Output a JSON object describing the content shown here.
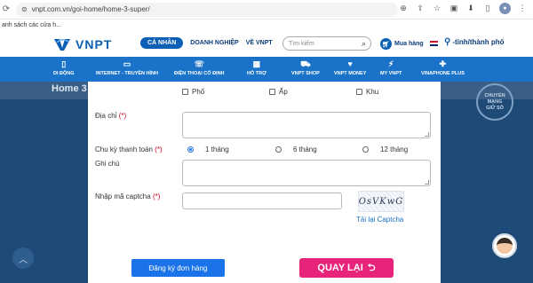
{
  "browser": {
    "url": "vnpt.com.vn/goi-home/home-3-super/",
    "bookmark_text": "anh sách các cửa h..."
  },
  "header": {
    "logo_text": "VNPT",
    "nav": [
      "CÁ NHÂN",
      "DOANH NGHIỆP",
      "VỀ VNPT"
    ],
    "search_placeholder": "Tìm kiếm",
    "cart_label": "Mua hàng",
    "location_label": "-tỉnh/thành phố"
  },
  "menu": [
    {
      "label": "DI ĐỘNG",
      "icon": "phone-icon"
    },
    {
      "label": "INTERNET - TRUYỀN HÌNH",
      "icon": "tv-icon"
    },
    {
      "label": "ĐIỆN THOẠI CỐ ĐỊNH",
      "icon": "landline-icon"
    },
    {
      "label": "HỖ TRỢ",
      "icon": "grid-icon"
    },
    {
      "label": "VNPT SHOP",
      "icon": "cart-icon"
    },
    {
      "label": "VNPT MONEY",
      "icon": "heart-icon"
    },
    {
      "label": "MY VNPT",
      "icon": "my-vnpt-icon"
    },
    {
      "label": "VINAPHONE PLUS",
      "icon": "plus-icon"
    }
  ],
  "page": {
    "breadcrumb": "Home 3",
    "badge_lines": [
      "CHUYỂN",
      "MẠNG",
      "GIỮ SỐ"
    ]
  },
  "form": {
    "area_options": [
      "Phố",
      "Ấp",
      "Khu"
    ],
    "address_label": "Địa chỉ",
    "cycle_label": "Chu kỳ thanh toán",
    "cycle_options": [
      "1 tháng",
      "6 tháng",
      "12 tháng"
    ],
    "cycle_selected": "1 tháng",
    "note_label": "Ghi chú",
    "captcha_label": "Nhập mã captcha",
    "required_mark": "(*)",
    "captcha_text": "OsVKwG",
    "captcha_reload": "Tải lại Captcha",
    "submit_label": "Đăng ký đơn hàng",
    "back_label": "QUAY LẠI"
  }
}
